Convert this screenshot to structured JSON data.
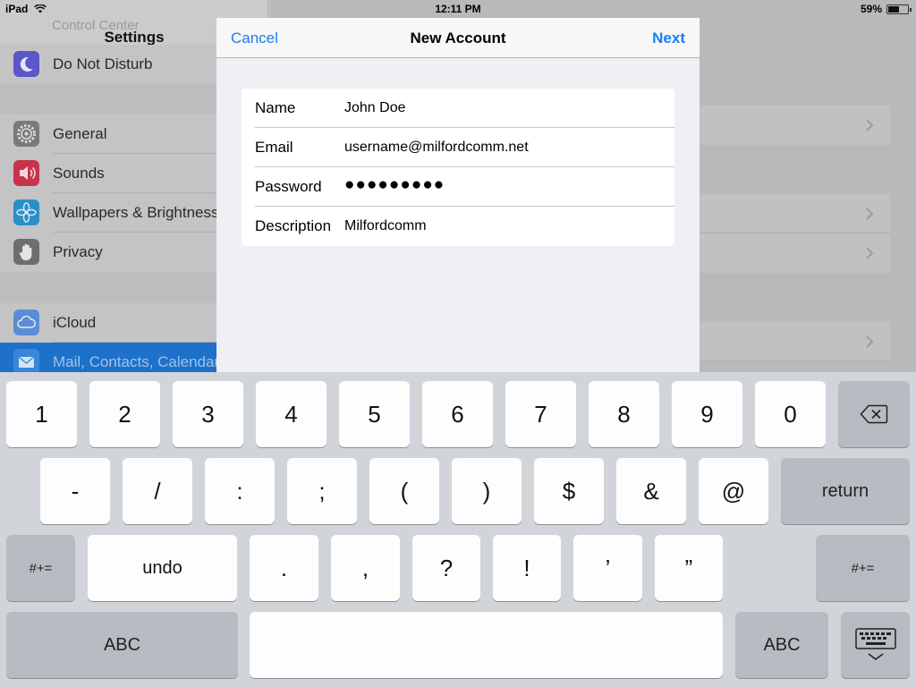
{
  "status_bar": {
    "device": "iPad",
    "time": "12:11 PM",
    "battery": "59%",
    "battery_fraction": 0.59
  },
  "settings": {
    "title": "Settings",
    "ghost_row": "Control Center",
    "items": [
      {
        "label": "Do Not Disturb",
        "icon": "moon-icon",
        "color": "#5a57c9"
      },
      {
        "label": "General",
        "icon": "gear-icon",
        "color": "#7a7a7c"
      },
      {
        "label": "Sounds",
        "icon": "speaker-icon",
        "color": "#c8334a"
      },
      {
        "label": "Wallpapers & Brightness",
        "icon": "flower-icon",
        "color": "#2b8fc7"
      },
      {
        "label": "Privacy",
        "icon": "hand-icon",
        "color": "#6e6e70"
      },
      {
        "label": "iCloud",
        "icon": "cloud-icon",
        "color": "#5b8dd6"
      },
      {
        "label": "Mail, Contacts, Calendars",
        "icon": "envelope-icon",
        "color": "#3a86d9"
      }
    ]
  },
  "modal": {
    "cancel": "Cancel",
    "title": "New Account",
    "next": "Next",
    "fields": [
      {
        "label": "Name",
        "value": "John Doe"
      },
      {
        "label": "Email",
        "value": "username@milfordcomm.net"
      },
      {
        "label": "Password",
        "value": "●●●●●●●●●"
      },
      {
        "label": "Description",
        "value": "Milfordcomm"
      }
    ]
  },
  "keyboard": {
    "row1": [
      "1",
      "2",
      "3",
      "4",
      "5",
      "6",
      "7",
      "8",
      "9",
      "0"
    ],
    "row2": [
      "-",
      "/",
      ":",
      ";",
      "(",
      ")",
      "$",
      "&",
      "@"
    ],
    "return": "return",
    "shift": "#+=",
    "undo": "undo",
    "row3": [
      ".",
      ",",
      "?",
      "!",
      "’",
      "”"
    ],
    "abc": "ABC",
    "backspace_icon": "backspace-icon",
    "dismiss_icon": "keyboard-dismiss-icon"
  }
}
